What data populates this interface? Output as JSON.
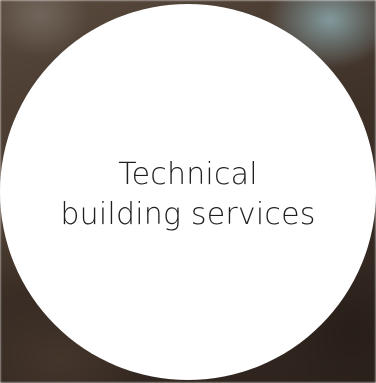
{
  "card": {
    "title_line1": "Technical",
    "title_line2": "building services"
  },
  "colors": {
    "circle_fill": "#ffffff",
    "text": "#1f1f1f"
  }
}
